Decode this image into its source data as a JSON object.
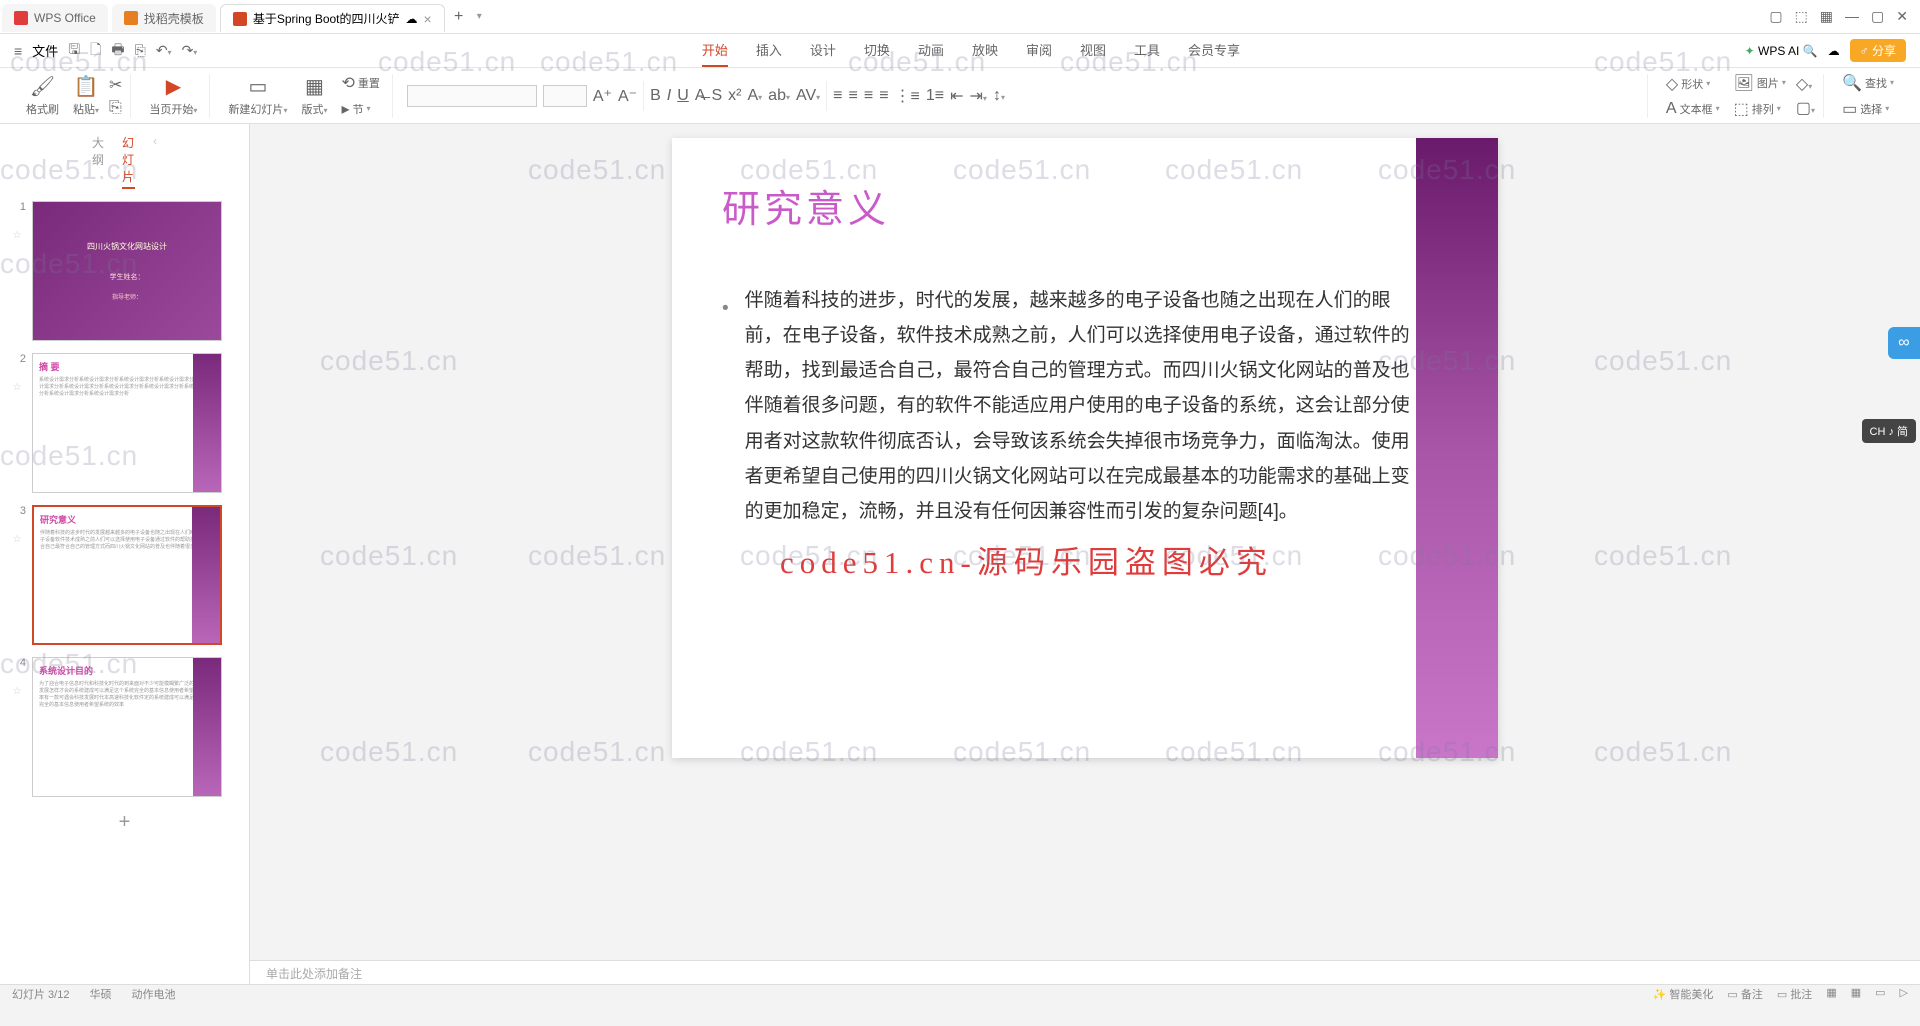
{
  "titlebar": {
    "tabs": [
      {
        "label": "WPS Office",
        "icon": "wps"
      },
      {
        "label": "找稻壳模板",
        "icon": "doc"
      },
      {
        "label": "基于Spring Boot的四川火铲",
        "icon": "ppt"
      }
    ],
    "dropdown": "▾"
  },
  "menubar": {
    "file": "文件",
    "tabs": [
      "开始",
      "插入",
      "设计",
      "切换",
      "动画",
      "放映",
      "审阅",
      "视图",
      "工具",
      "会员专享"
    ],
    "active": "开始",
    "wpsai": "WPS AI",
    "share": "分享"
  },
  "ribbon": {
    "format_painter": "格式刷",
    "paste": "粘贴",
    "from_start": "当页开始",
    "new_slide": "新建幻灯片",
    "layout": "版式",
    "reset": "重置",
    "section": "节",
    "shape": "形状",
    "picture": "图片",
    "textbox": "文本框",
    "arrange": "排列",
    "find": "查找",
    "select": "选择"
  },
  "panel": {
    "tabs": [
      "大纲",
      "幻灯片"
    ],
    "active": "幻灯片",
    "slides": [
      {
        "num": "1",
        "title": "四川火锅文化网站设计",
        "sub": "学生姓名：",
        "sub2": "指导老师："
      },
      {
        "num": "2",
        "title": "摘 要"
      },
      {
        "num": "3",
        "title": "研究意义"
      },
      {
        "num": "4",
        "title": "系统设计目的"
      }
    ]
  },
  "slide": {
    "title": "研究意义",
    "body": "伴随着科技的进步，时代的发展，越来越多的电子设备也随之出现在人们的眼前，在电子设备，软件技术成熟之前，人们可以选择使用电子设备，通过软件的帮助，找到最适合自己，最符合自己的管理方式。而四川火锅文化网站的普及也伴随着很多问题，有的软件不能适应用户使用的电子设备的系统，这会让部分使用者对这款软件彻底否认，会导致该系统会失掉很市场竞争力，面临淘汰。使用者更希望自己使用的四川火锅文化网站可以在完成最基本的功能需求的基础上变的更加稳定，流畅，并且没有任何因兼容性而引发的复杂问题[4]。"
  },
  "overlay_wm": "code51.cn-源码乐园盗图必究",
  "notes": "单击此处添加备注",
  "status": {
    "left1": "幻灯片 3/12",
    "left2": "华硕",
    "left3": "动作电池",
    "r1": "智能美化",
    "r2": "备注",
    "r3": "批注"
  },
  "ime": "CH ♪ 简",
  "watermarks": [
    "code51.cn"
  ]
}
